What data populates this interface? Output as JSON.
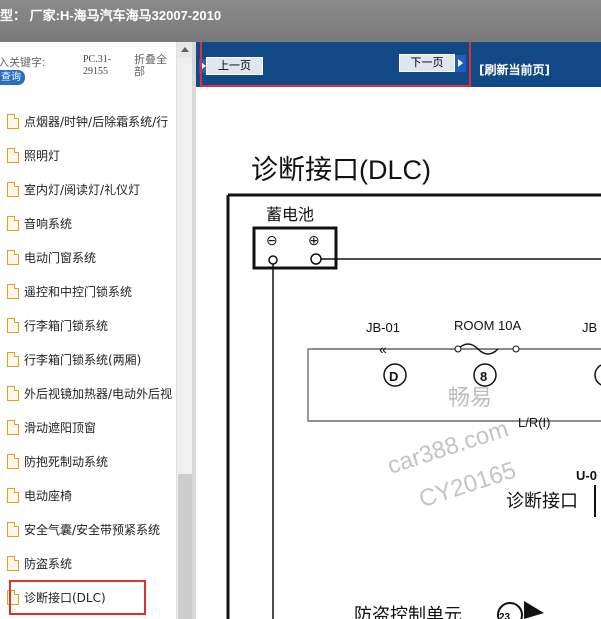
{
  "window": {
    "title": "型： 厂家:H-海马汽车海马32007-2010"
  },
  "sidebar": {
    "keyword_label": "入关键字:",
    "query_button": "查询",
    "pc_code": "PC.31-29155",
    "fold_all": "折叠全部",
    "items": [
      {
        "label": "点烟器/时钟/后除霜系统/行"
      },
      {
        "label": "照明灯"
      },
      {
        "label": "室内灯/阅读灯/礼仪灯"
      },
      {
        "label": "音响系统"
      },
      {
        "label": "电动门窗系统"
      },
      {
        "label": "遥控和中控门锁系统"
      },
      {
        "label": "行李箱门锁系统"
      },
      {
        "label": "行李箱门锁系统(两厢)"
      },
      {
        "label": "外后视镜加热器/电动外后视"
      },
      {
        "label": "滑动遮阳顶窗"
      },
      {
        "label": "防抱死制动系统"
      },
      {
        "label": "电动座椅"
      },
      {
        "label": "安全气囊/安全带预紧系统"
      },
      {
        "label": "防盗系统"
      },
      {
        "label": "诊断接口(DLC)"
      }
    ],
    "selected_item": "诊断接口(DLC)"
  },
  "toolbar": {
    "prev_label": "上一页",
    "next_label": "下一页",
    "refresh_label": "[刷新当前页]"
  },
  "diagram": {
    "title": "诊断接口(DLC)",
    "battery_label": "蓄电池",
    "battery_minus": "⊖",
    "battery_plus": "⊕",
    "jb01": "JB-01",
    "jb_partial": "JB",
    "room_fuse": "ROOM 10A",
    "node_d": "D",
    "node_8": "8",
    "wire_label": "L/R(I)",
    "u_code": "U-0",
    "dlc_label": "诊断接口",
    "antitheft_label": "防盗控制单元",
    "node_bottom": "23",
    "watermark_line1": "畅易",
    "watermark_line2": "car388.com",
    "watermark_line3": "CY20165"
  }
}
